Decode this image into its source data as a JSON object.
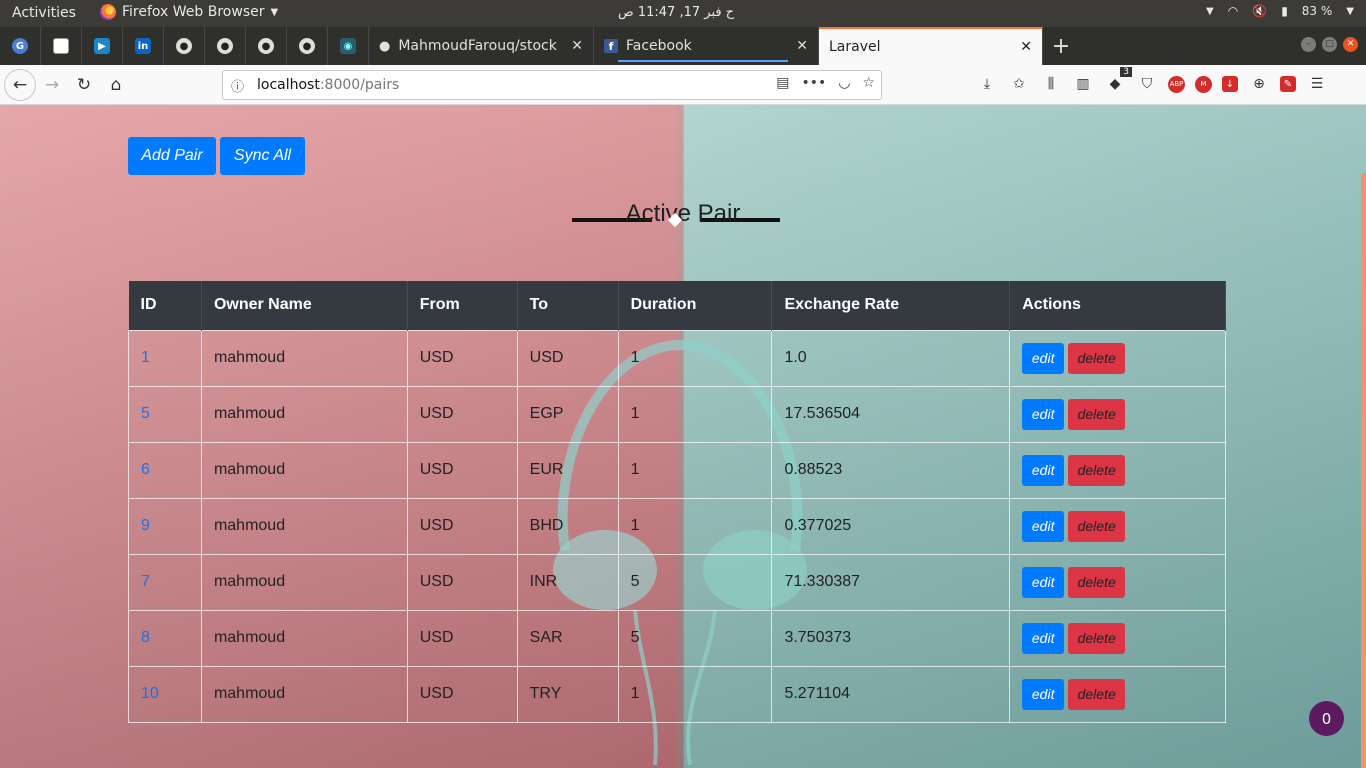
{
  "topbar": {
    "activities": "Activities",
    "app_name": "Firefox Web Browser",
    "clock": "ح فبر 17, 11:47 ص",
    "battery": "83 %"
  },
  "tabs": [
    {
      "title": "MahmoudFarouq/stock",
      "icon": "github-icon"
    },
    {
      "title": "Facebook",
      "icon": "facebook-icon"
    },
    {
      "title": "Laravel",
      "icon": "none",
      "active": true
    }
  ],
  "urlbar": {
    "host": "localhost",
    "path": ":8000/pairs"
  },
  "toolbar": {
    "badge_count": "3",
    "abp_label": "ABP"
  },
  "page": {
    "add_pair_label": "Add Pair",
    "sync_all_label": "Sync All",
    "heading": "Active Pair",
    "columns": [
      "ID",
      "Owner Name",
      "From",
      "To",
      "Duration",
      "Exchange Rate",
      "Actions"
    ],
    "edit_label": "edit",
    "delete_label": "delete",
    "rows": [
      {
        "id": "1",
        "owner": "mahmoud",
        "from": "USD",
        "to": "USD",
        "duration": "1",
        "rate": "1.0"
      },
      {
        "id": "5",
        "owner": "mahmoud",
        "from": "USD",
        "to": "EGP",
        "duration": "1",
        "rate": "17.536504"
      },
      {
        "id": "6",
        "owner": "mahmoud",
        "from": "USD",
        "to": "EUR",
        "duration": "1",
        "rate": "0.88523"
      },
      {
        "id": "9",
        "owner": "mahmoud",
        "from": "USD",
        "to": "BHD",
        "duration": "1",
        "rate": "0.377025"
      },
      {
        "id": "7",
        "owner": "mahmoud",
        "from": "USD",
        "to": "INR",
        "duration": "5",
        "rate": "71.330387"
      },
      {
        "id": "8",
        "owner": "mahmoud",
        "from": "USD",
        "to": "SAR",
        "duration": "5",
        "rate": "3.750373"
      },
      {
        "id": "10",
        "owner": "mahmoud",
        "from": "USD",
        "to": "TRY",
        "duration": "1",
        "rate": "5.271104"
      }
    ],
    "chat_count": "0"
  },
  "colors": {
    "primary": "#007bff",
    "danger": "#dc3545",
    "table_head": "#343a40",
    "chat_bubble": "#5b1b5e"
  }
}
